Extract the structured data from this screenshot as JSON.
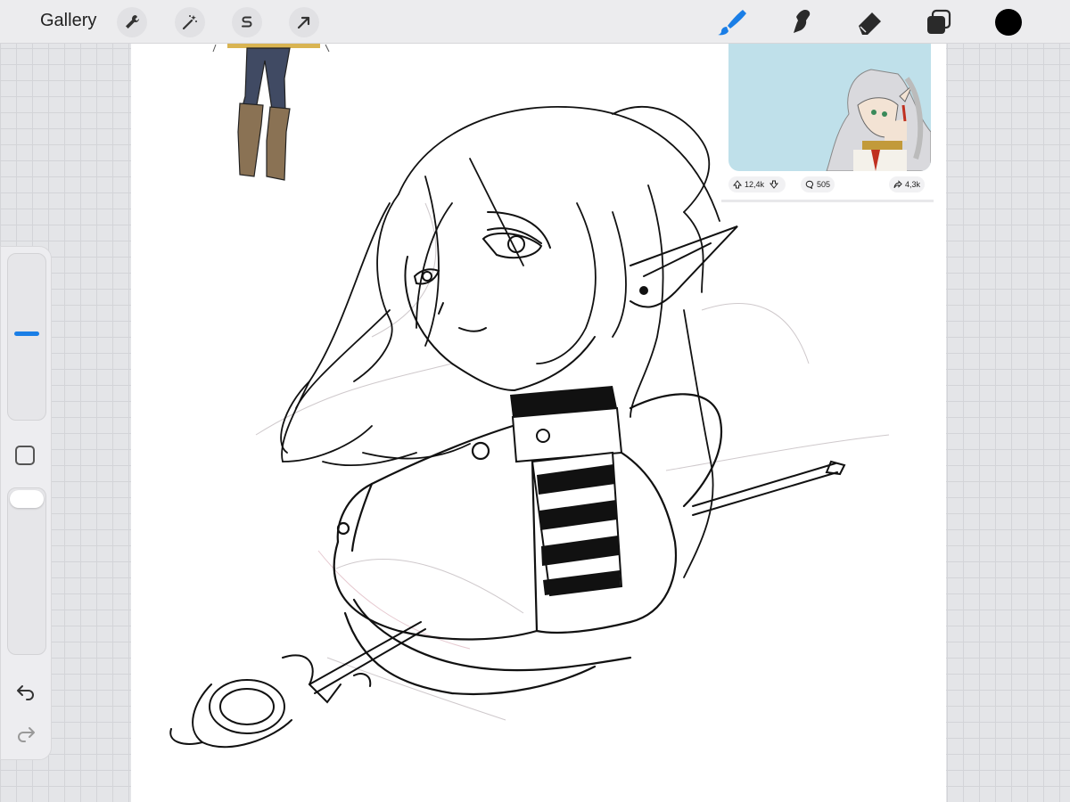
{
  "toolbar": {
    "gallery_label": "Gallery",
    "left_tools": [
      "wrench-icon",
      "magic-wand-icon",
      "selection-s-icon",
      "transform-arrow-icon"
    ],
    "right_tools": [
      "brush-icon",
      "smudge-icon",
      "eraser-icon",
      "layers-icon",
      "color-swatch"
    ],
    "active_tool": "brush",
    "current_color": "#000000",
    "brush_accent": "#1a7ee6"
  },
  "reference": {
    "upvotes": "12,4k",
    "comments": "505",
    "shares": "4,3k",
    "background": "#bfe0ea"
  },
  "sidebar": {
    "brush_size_level": 0.52,
    "opacity_level": 1.0,
    "controls": [
      "brush-size-slider",
      "modify-button",
      "opacity-slider",
      "undo-icon",
      "redo-icon"
    ],
    "accent": "#1a7ee6"
  }
}
